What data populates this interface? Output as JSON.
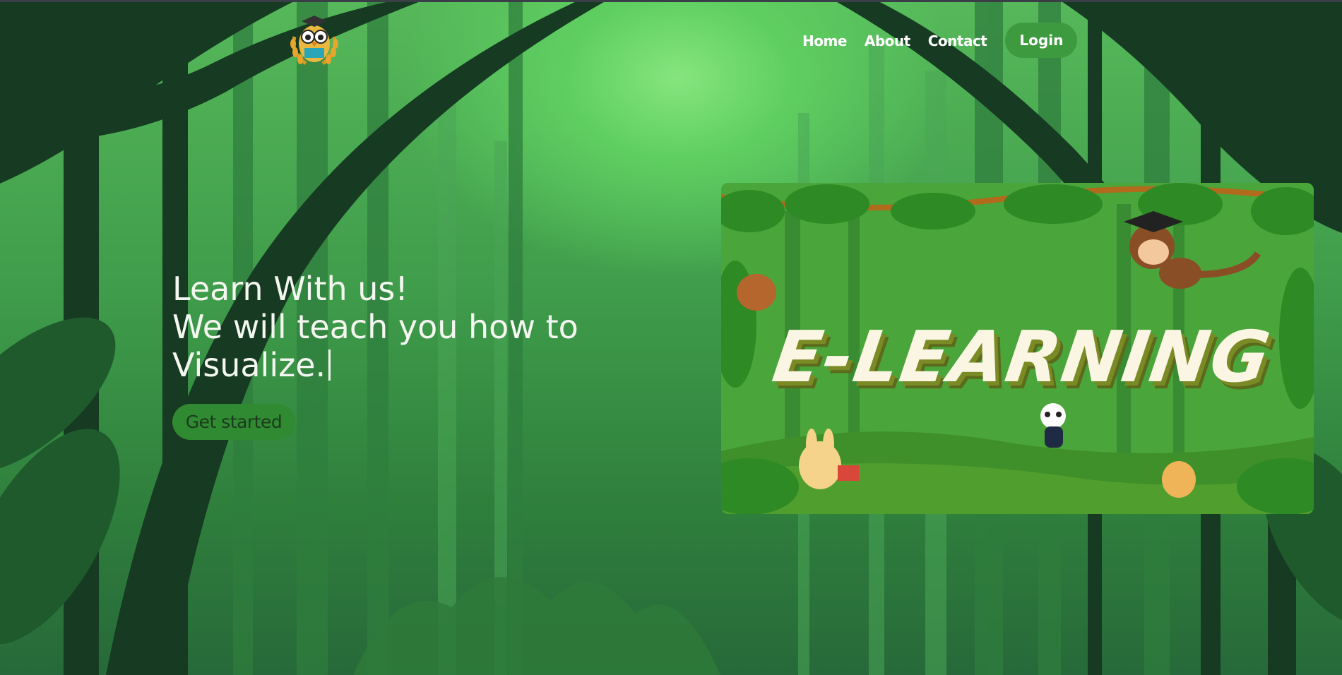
{
  "nav": {
    "home": "Home",
    "about": "About",
    "contact": "Contact",
    "login": "Login"
  },
  "hero": {
    "line1": "Learn With us!",
    "line2": "We will teach you how to",
    "line3": "Visualize.",
    "cta": "Get started"
  },
  "banner": {
    "title": "E-LEARNING"
  },
  "icons": {
    "logo": "owl-graduate-logo"
  },
  "colors": {
    "button_green": "#3e9a3f",
    "hero_text": "#f4f7f0",
    "banner_title": "#fbf6e4"
  }
}
